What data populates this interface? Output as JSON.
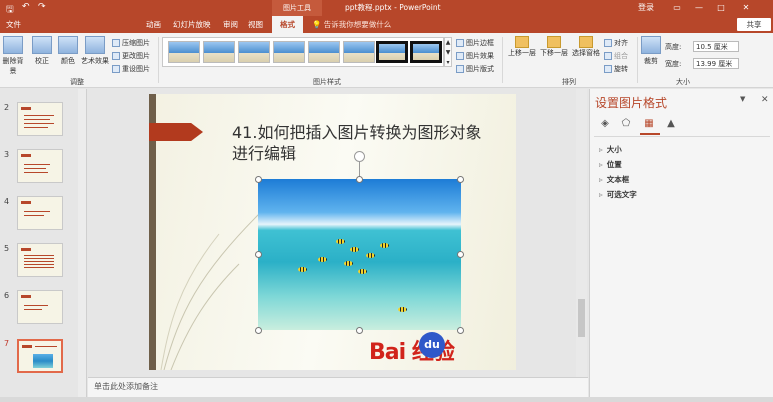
{
  "titlebar": {
    "picture_tools": "图片工具",
    "doc_title": "ppt教程.pptx - PowerPoint",
    "login": "登录",
    "restore": "▭",
    "minimize": "—",
    "maximize": "□",
    "close": "✕"
  },
  "quick_access": {
    "save": "🖫",
    "undo": "↶",
    "redo": "↷"
  },
  "tabs": {
    "file": "文件",
    "animation": "动画",
    "slideshow": "幻灯片放映",
    "review": "审阅",
    "view": "视图",
    "format": "格式"
  },
  "tellme": "💡 告诉我你想要做什么",
  "share": "共享",
  "ribbon": {
    "remove_bg": "删除背景",
    "correct": "校正",
    "color": "颜色",
    "art_effects": "艺术效果",
    "compress": "压缩图片",
    "change_pic": "更改图片",
    "reset_pic": "重设图片",
    "adjust_label": "调整",
    "styles_label": "图片样式",
    "border": "图片边框",
    "effects": "图片效果",
    "layout": "图片版式",
    "bring_forward": "上移一层",
    "send_backward": "下移一层",
    "selection_pane": "选择窗格",
    "align": "对齐",
    "group": "组合",
    "rotate": "旋转",
    "arrange_label": "排列",
    "crop": "裁剪",
    "height_label": "高度:",
    "height_value": "10.5 厘米",
    "width_label": "宽度:",
    "width_value": "13.99 厘米",
    "size_label": "大小"
  },
  "thumbnails": {
    "n2": "2",
    "n3": "3",
    "n4": "4",
    "n5": "5",
    "n6": "6",
    "n7": "7"
  },
  "slide": {
    "title": "41.如何把插入图片转换为图形对象进行编辑",
    "watermark": "Bai  经验",
    "watermark_du": "du"
  },
  "notes": "单击此处添加备注",
  "format_pane": {
    "title": "设置图片格式",
    "dropdown": "▼",
    "close": "✕",
    "sections": {
      "size": "大小",
      "position": "位置",
      "textbox": "文本框",
      "alt_text": "可选文字"
    }
  },
  "colors": {
    "accent": "#b7472a",
    "arrow": "#b23a1e",
    "baidu_red": "#d1241b",
    "baidu_blue": "#2f58c9"
  }
}
